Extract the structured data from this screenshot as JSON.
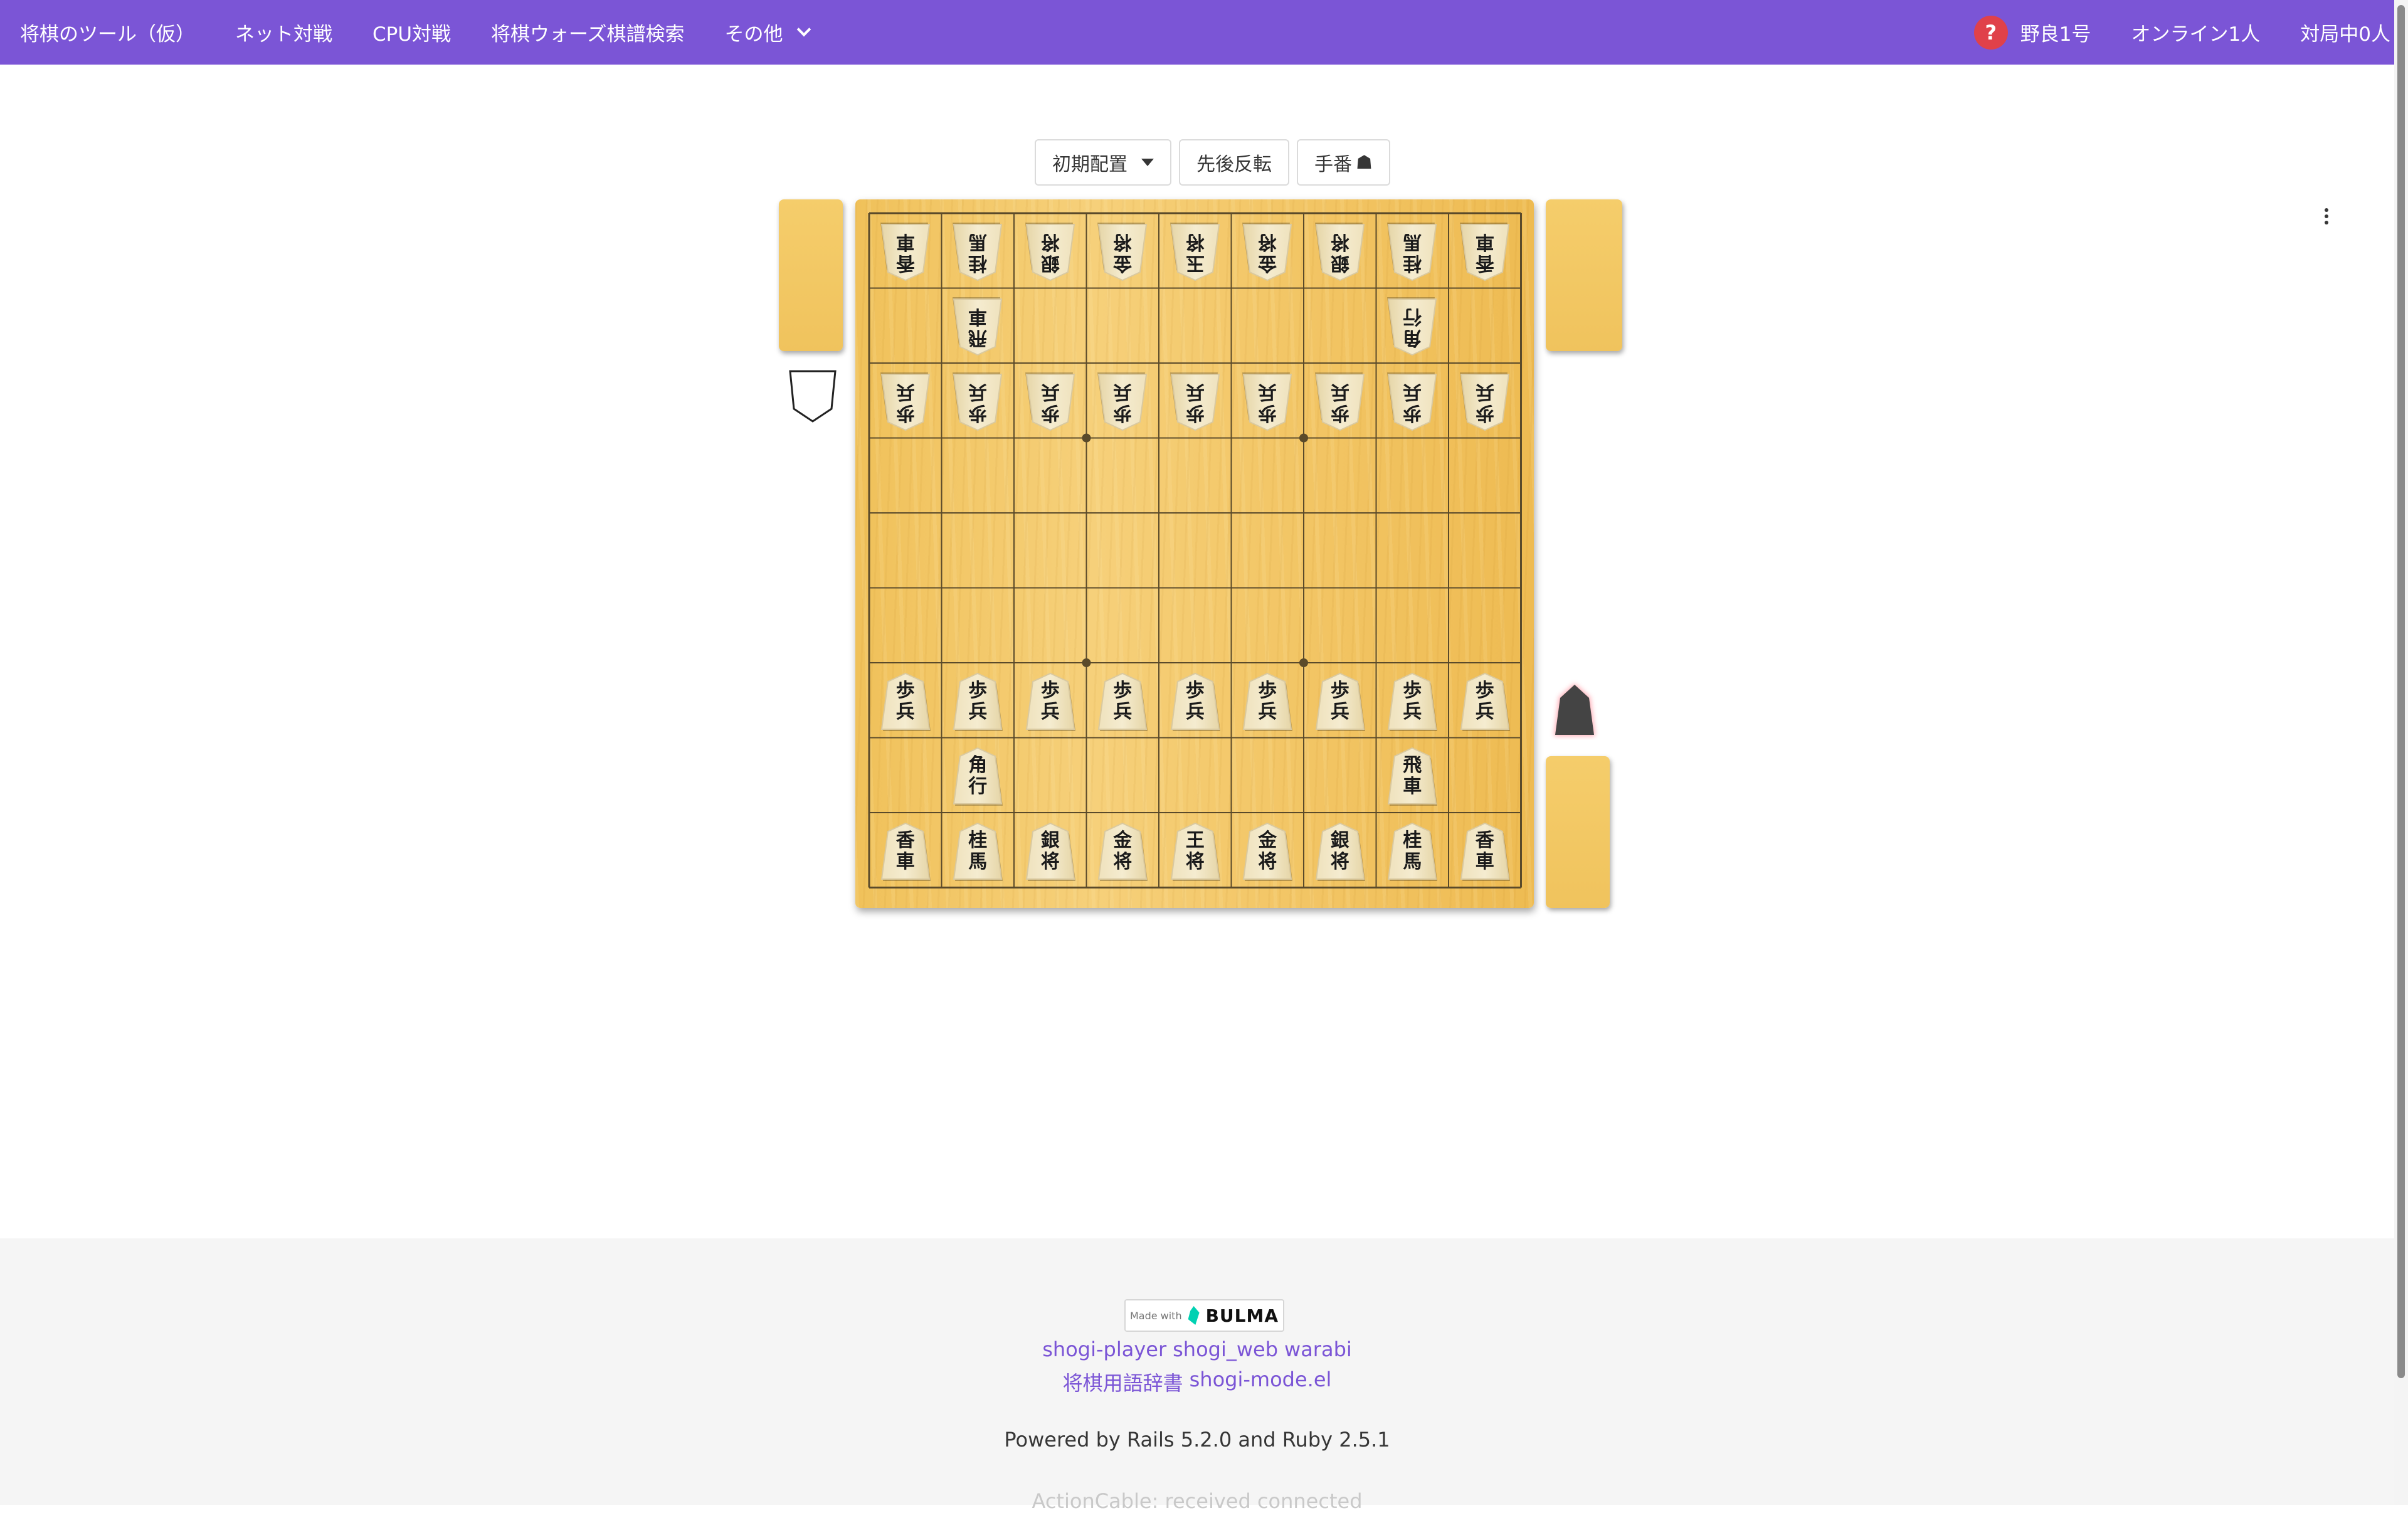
{
  "navbar": {
    "brand": "将棋のツール（仮）",
    "items": [
      "ネット対戦",
      "CPU対戦",
      "将棋ウォーズ棋譜検索",
      "その他"
    ],
    "user_badge": "?",
    "user_name": "野良1号",
    "online": "オンライン1人",
    "playing": "対局中0人"
  },
  "toolbar": {
    "initial_setup": "初期配置",
    "flip": "先後反転",
    "turn": "手番",
    "turn_icon": "☗"
  },
  "board": {
    "columns": 9,
    "rows": 9,
    "gote_pieces": [
      {
        "row": 0,
        "col": 0,
        "label": "香\n車"
      },
      {
        "row": 0,
        "col": 1,
        "label": "桂\n馬"
      },
      {
        "row": 0,
        "col": 2,
        "label": "銀\n将"
      },
      {
        "row": 0,
        "col": 3,
        "label": "金\n将"
      },
      {
        "row": 0,
        "col": 4,
        "label": "玉\n将"
      },
      {
        "row": 0,
        "col": 5,
        "label": "金\n将"
      },
      {
        "row": 0,
        "col": 6,
        "label": "銀\n将"
      },
      {
        "row": 0,
        "col": 7,
        "label": "桂\n馬"
      },
      {
        "row": 0,
        "col": 8,
        "label": "香\n車"
      },
      {
        "row": 1,
        "col": 1,
        "label": "飛\n車"
      },
      {
        "row": 1,
        "col": 7,
        "label": "角\n行"
      },
      {
        "row": 2,
        "col": 0,
        "label": "歩\n兵"
      },
      {
        "row": 2,
        "col": 1,
        "label": "歩\n兵"
      },
      {
        "row": 2,
        "col": 2,
        "label": "歩\n兵"
      },
      {
        "row": 2,
        "col": 3,
        "label": "歩\n兵"
      },
      {
        "row": 2,
        "col": 4,
        "label": "歩\n兵"
      },
      {
        "row": 2,
        "col": 5,
        "label": "歩\n兵"
      },
      {
        "row": 2,
        "col": 6,
        "label": "歩\n兵"
      },
      {
        "row": 2,
        "col": 7,
        "label": "歩\n兵"
      },
      {
        "row": 2,
        "col": 8,
        "label": "歩\n兵"
      }
    ],
    "sente_pieces": [
      {
        "row": 6,
        "col": 0,
        "label": "歩\n兵"
      },
      {
        "row": 6,
        "col": 1,
        "label": "歩\n兵"
      },
      {
        "row": 6,
        "col": 2,
        "label": "歩\n兵"
      },
      {
        "row": 6,
        "col": 3,
        "label": "歩\n兵"
      },
      {
        "row": 6,
        "col": 4,
        "label": "歩\n兵"
      },
      {
        "row": 6,
        "col": 5,
        "label": "歩\n兵"
      },
      {
        "row": 6,
        "col": 6,
        "label": "歩\n兵"
      },
      {
        "row": 6,
        "col": 7,
        "label": "歩\n兵"
      },
      {
        "row": 6,
        "col": 8,
        "label": "歩\n兵"
      },
      {
        "row": 7,
        "col": 1,
        "label": "角\n行"
      },
      {
        "row": 7,
        "col": 7,
        "label": "飛\n車"
      },
      {
        "row": 8,
        "col": 0,
        "label": "香\n車"
      },
      {
        "row": 8,
        "col": 1,
        "label": "桂\n馬"
      },
      {
        "row": 8,
        "col": 2,
        "label": "銀\n将"
      },
      {
        "row": 8,
        "col": 3,
        "label": "金\n将"
      },
      {
        "row": 8,
        "col": 4,
        "label": "王\n将"
      },
      {
        "row": 8,
        "col": 5,
        "label": "金\n将"
      },
      {
        "row": 8,
        "col": 6,
        "label": "銀\n将"
      },
      {
        "row": 8,
        "col": 7,
        "label": "桂\n馬"
      },
      {
        "row": 8,
        "col": 8,
        "label": "香\n車"
      }
    ],
    "colors": {
      "piece_face": "#f5ecd0",
      "piece_edge": "#d9c9a0",
      "line": "#5a4a2a",
      "sente_marker": "#3f3f3f",
      "gote_marker": "#ffffff"
    }
  },
  "footer": {
    "made_with": "Made with",
    "bulma": "BULMA",
    "links_row1": [
      "shogi-player",
      "shogi_web",
      "warabi"
    ],
    "links_row2": [
      "将棋用語辞書",
      "shogi-mode.el"
    ],
    "powered": "Powered by Rails 5.2.0 and Ruby 2.5.1",
    "cable": "ActionCable: received connected"
  }
}
